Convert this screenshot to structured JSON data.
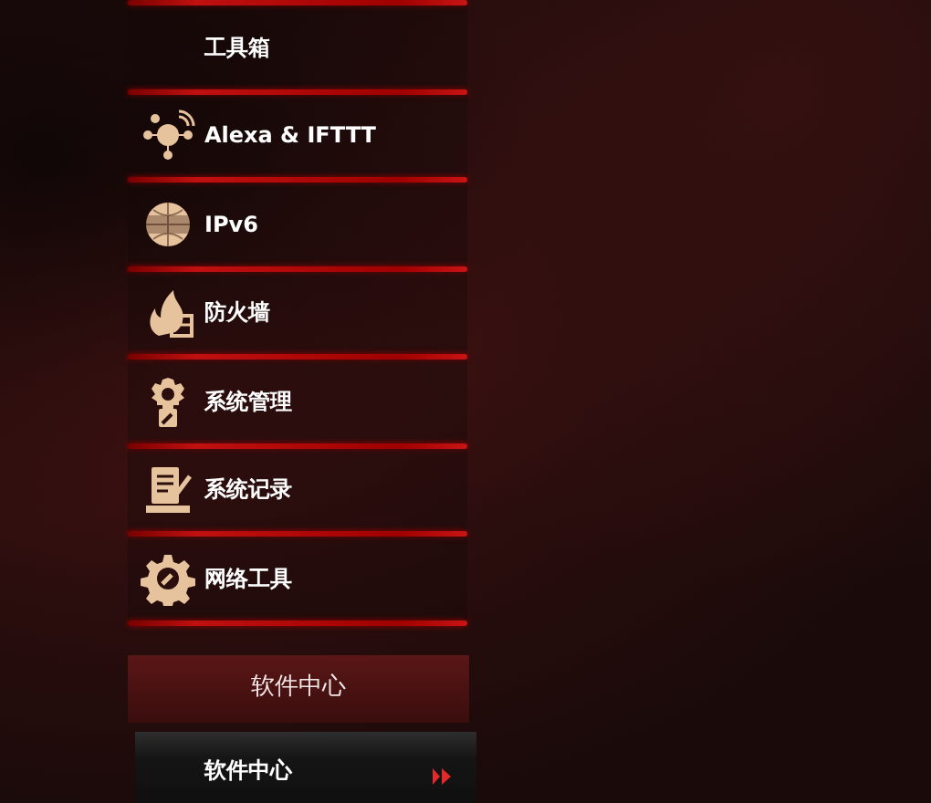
{
  "menu": [
    {
      "label": "工具箱"
    },
    {
      "label": "Alexa & IFTTT"
    },
    {
      "label": "IPv6"
    },
    {
      "label": "防火墙"
    },
    {
      "label": "系统管理"
    },
    {
      "label": "系统记录"
    },
    {
      "label": "网络工具"
    }
  ],
  "section_header": "软件中心",
  "submenu": [
    {
      "label": "软件中心",
      "selected": true
    }
  ]
}
